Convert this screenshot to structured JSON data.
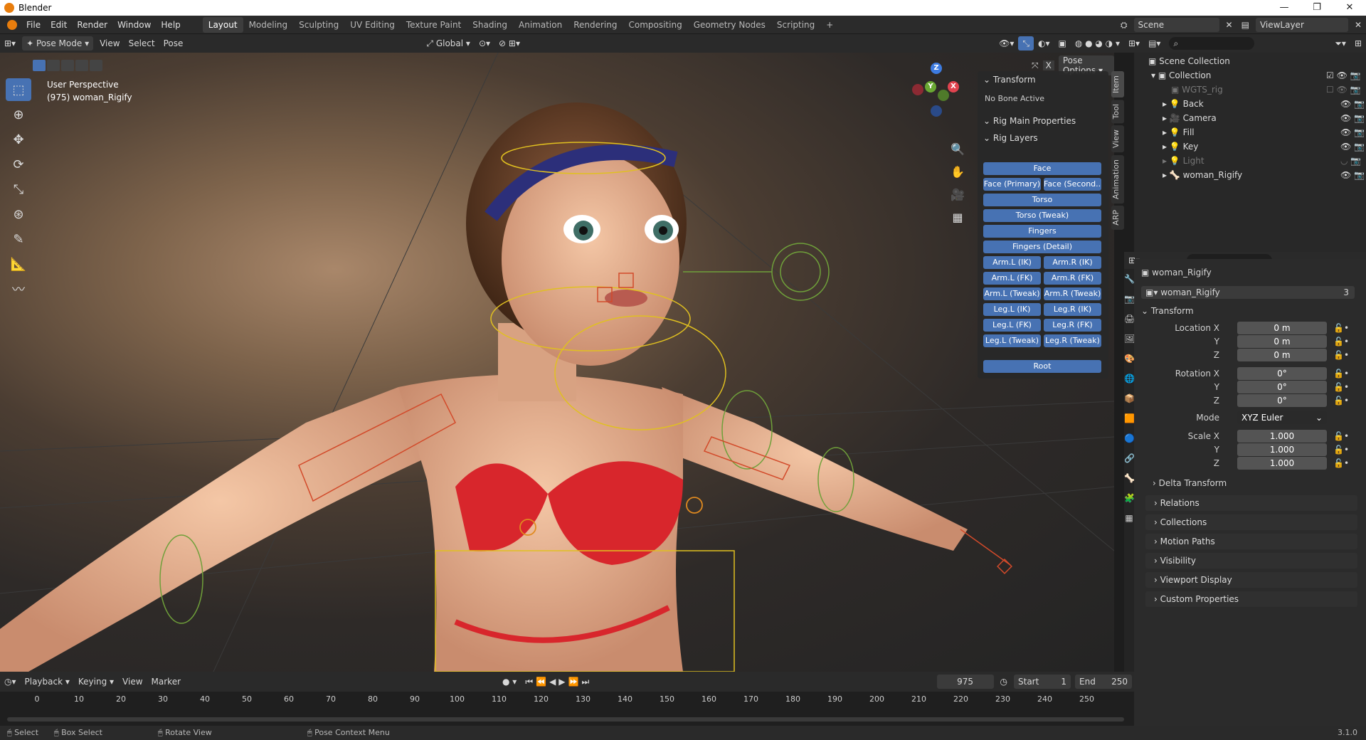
{
  "title_bar": {
    "app_title": "Blender",
    "minimize": "—",
    "restore": "❐",
    "close": "✕"
  },
  "menu": [
    "File",
    "Edit",
    "Render",
    "Window",
    "Help"
  ],
  "workspaces": [
    "Layout",
    "Modeling",
    "Sculpting",
    "UV Editing",
    "Texture Paint",
    "Shading",
    "Animation",
    "Rendering",
    "Compositing",
    "Geometry Nodes",
    "Scripting",
    "+"
  ],
  "active_workspace": "Layout",
  "scene": {
    "label": "Scene",
    "view_layer": "ViewLayer"
  },
  "viewport_header": {
    "mode": "Pose Mode",
    "menus": [
      "View",
      "Select",
      "Pose"
    ],
    "orientation": "Global",
    "pose_options": "Pose Options"
  },
  "viewport": {
    "perspective": "User Perspective",
    "object_info": "(975) woman_Rigify"
  },
  "gizmo": {
    "x": "X",
    "y": "Y",
    "z": "Z"
  },
  "npanel": {
    "transform_header": "Transform",
    "no_bone": "No Bone Active",
    "rig_main": "Rig Main Properties",
    "rig_layers": "Rig Layers",
    "layers": {
      "face": "Face",
      "face_primary": "Face (Primary)",
      "face_second": "Face (Second...",
      "torso": "Torso",
      "torso_tweak": "Torso (Tweak)",
      "fingers": "Fingers",
      "fingers_detail": "Fingers (Detail)",
      "arm_l_ik": "Arm.L (IK)",
      "arm_r_ik": "Arm.R (IK)",
      "arm_l_fk": "Arm.L (FK)",
      "arm_r_fk": "Arm.R (FK)",
      "arm_l_tweak": "Arm.L (Tweak)",
      "arm_r_tweak": "Arm.R (Tweak)",
      "leg_l_ik": "Leg.L (IK)",
      "leg_r_ik": "Leg.R (IK)",
      "leg_l_fk": "Leg.L (FK)",
      "leg_r_fk": "Leg.R (FK)",
      "leg_l_tweak": "Leg.L (Tweak)",
      "leg_r_tweak": "Leg.R (Tweak)",
      "root": "Root"
    },
    "tabs": [
      "Item",
      "Tool",
      "View",
      "Animation",
      "ARP"
    ]
  },
  "outliner": {
    "scene_collection": "Scene Collection",
    "collection": "Collection",
    "items": [
      {
        "name": "WGTS_rig",
        "dim": true
      },
      {
        "name": "Back",
        "dim": false
      },
      {
        "name": "Camera",
        "dim": false
      },
      {
        "name": "Fill",
        "dim": false
      },
      {
        "name": "Key",
        "dim": false
      },
      {
        "name": "Light",
        "dim": true
      },
      {
        "name": "woman_Rigify",
        "dim": false
      }
    ]
  },
  "properties": {
    "object_name": "woman_Rigify",
    "data_name": "woman_Rigify",
    "users": "3",
    "transform": "Transform",
    "location": {
      "label_x": "Location X",
      "x": "0 m",
      "y": "0 m",
      "z": "0 m"
    },
    "rotation": {
      "label_x": "Rotation X",
      "x": "0°",
      "y": "0°",
      "z": "0°"
    },
    "mode_label": "Mode",
    "mode_value": "XYZ Euler",
    "scale": {
      "label_x": "Scale X",
      "x": "1.000",
      "y": "1.000",
      "z": "1.000"
    },
    "axis_y": "Y",
    "axis_z": "Z",
    "delta": "Delta Transform",
    "sections": [
      "Relations",
      "Collections",
      "Motion Paths",
      "Visibility",
      "Viewport Display",
      "Custom Properties"
    ]
  },
  "timeline": {
    "menus": [
      "Playback",
      "Keying",
      "View",
      "Marker"
    ],
    "current_frame": "975",
    "start_label": "Start",
    "start": "1",
    "end_label": "End",
    "end": "250",
    "ticks": [
      "0",
      "10",
      "20",
      "30",
      "40",
      "50",
      "60",
      "70",
      "80",
      "90",
      "100",
      "110",
      "120",
      "130",
      "140",
      "150",
      "160",
      "170",
      "180",
      "190",
      "200",
      "210",
      "220",
      "230",
      "240",
      "250"
    ]
  },
  "statusbar": {
    "select": "Select",
    "box_select": "Box Select",
    "rotate": "Rotate View",
    "context": "Pose Context Menu",
    "version": "3.1.0"
  },
  "colors": {
    "accent": "#4772b3",
    "rig_yellow": "#e0c020",
    "rig_red": "#d24a2a",
    "rig_green": "#6fa03a",
    "bikini": "#d8262c"
  }
}
